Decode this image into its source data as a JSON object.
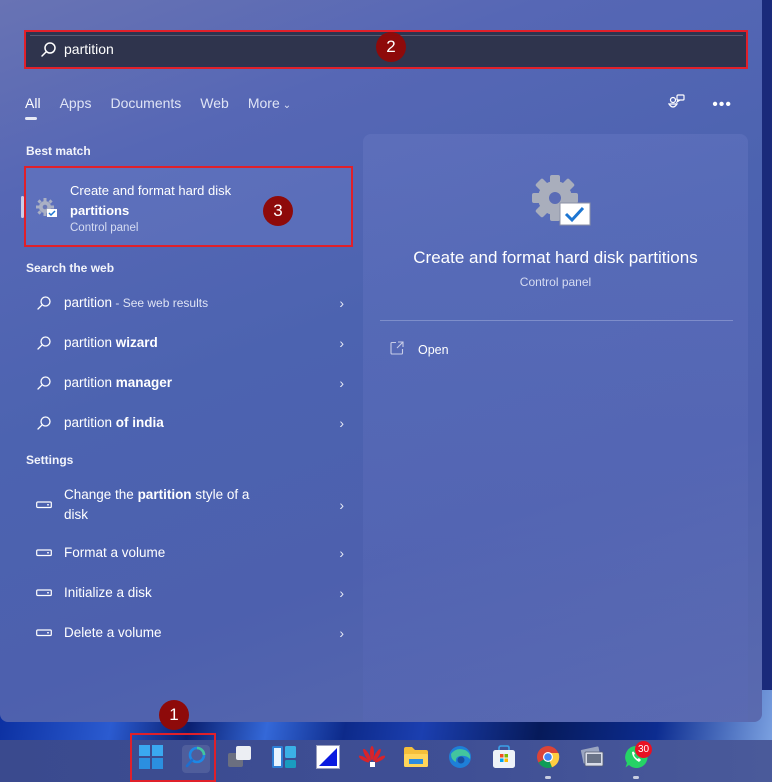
{
  "search": {
    "value": "partition",
    "icon": "search-icon"
  },
  "markers": [
    "1",
    "2",
    "3"
  ],
  "tabs": [
    {
      "label": "All",
      "active": true
    },
    {
      "label": "Apps",
      "active": false
    },
    {
      "label": "Documents",
      "active": false
    },
    {
      "label": "Web",
      "active": false
    },
    {
      "label": "More",
      "active": false,
      "has_dropdown": true
    }
  ],
  "top_icons": [
    "people-chat-icon",
    "more-options-icon"
  ],
  "best_match": {
    "section_label": "Best match",
    "title_prefix": "Create and format hard disk ",
    "title_bold": "partitions",
    "subtitle": "Control panel",
    "icon": "gear-check-icon"
  },
  "web": {
    "section_label": "Search the web",
    "items": [
      {
        "normal": "partition",
        "bold": "",
        "suffix": " - See web results"
      },
      {
        "normal": "partition ",
        "bold": "wizard",
        "suffix": ""
      },
      {
        "normal": "partition ",
        "bold": "manager",
        "suffix": ""
      },
      {
        "normal": "partition ",
        "bold": "of india",
        "suffix": ""
      }
    ]
  },
  "settings": {
    "section_label": "Settings",
    "items": [
      {
        "before": "Change the ",
        "bold": "partition",
        "after": " style of a disk"
      },
      {
        "before": "Format a volume",
        "bold": "",
        "after": ""
      },
      {
        "before": "Initialize a disk",
        "bold": "",
        "after": ""
      },
      {
        "before": "Delete a volume",
        "bold": "",
        "after": ""
      }
    ]
  },
  "preview": {
    "title": "Create and format hard disk partitions",
    "subtitle": "Control panel",
    "actions": [
      {
        "label": "Open",
        "icon": "open-external-icon"
      }
    ]
  },
  "taskbar": {
    "items": [
      {
        "name": "start-button",
        "icon": "windows-logo-icon"
      },
      {
        "name": "search-button",
        "icon": "search-icon"
      },
      {
        "name": "task-view-button",
        "icon": "task-view-icon"
      },
      {
        "name": "widgets-button",
        "icon": "widgets-icon"
      },
      {
        "name": "app-paint-button",
        "icon": "paint-app-icon"
      },
      {
        "name": "app-huawei-button",
        "icon": "huawei-icon"
      },
      {
        "name": "file-explorer-button",
        "icon": "folder-icon"
      },
      {
        "name": "edge-button",
        "icon": "edge-icon"
      },
      {
        "name": "store-button",
        "icon": "store-icon"
      },
      {
        "name": "chrome-button",
        "icon": "chrome-icon"
      },
      {
        "name": "photos-app-button",
        "icon": "photos-icon"
      },
      {
        "name": "whatsapp-button",
        "icon": "whatsapp-icon"
      }
    ],
    "whatsapp_badge": "30"
  },
  "colors": {
    "highlight_border": "#e0202a",
    "marker_fill": "#8e0a0a",
    "badge": "#e81123"
  }
}
